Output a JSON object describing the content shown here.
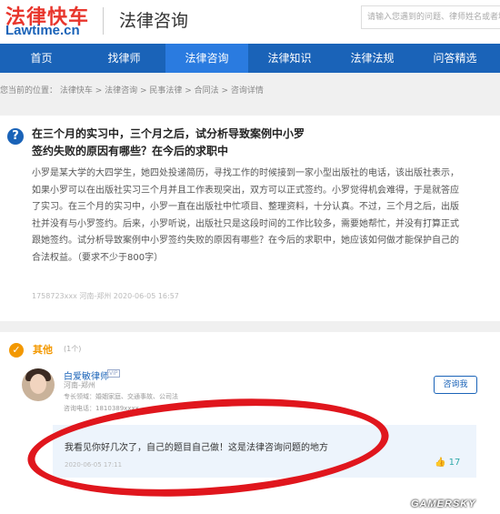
{
  "header": {
    "logo_cn": "法律快车",
    "logo_en": "Lawtime.cn",
    "site_title": "法律咨询",
    "search_placeholder": "请输入您遇到的问题、律师姓名或者地区"
  },
  "nav": [
    "首页",
    "找律师",
    "法律咨询",
    "法律知识",
    "法律法规",
    "问答精选"
  ],
  "breadcrumb": "您当前的位置：  法律快车 > 法律咨询 > 民事法律 > 合同法 > 咨询详情",
  "question": {
    "title": "在三个月的实习中，三个月之后，试分析导致案例中小罗签约失败的原因有哪些？在今后的求职中",
    "body": "小罗是某大学的大四学生，她四处投递简历，寻找工作的时候接到一家小型出版社的电话，该出版社表示，如果小罗可以在出版社实习三个月并且工作表现突出，双方可以正式签约。小罗觉得机会难得，于是就答应了实习。在三个月的实习中，小罗一直在出版社中忙项目、整理资料，十分认真。不过，三个月之后，出版社并没有与小罗签约。后来，小罗听说，出版社只是这段时间的工作比较多，需要她帮忙，并没有打算正式跟她签约。试分析导致案例中小罗签约失败的原因有哪些？在今后的求职中，她应该如何做才能保护自己的合法权益。（要求不少于800字）",
    "meta": "1758723xxx   河南-郑州      2020-06-05 16:57"
  },
  "answers": {
    "section_title": "其他",
    "count": "(1个)",
    "lawyer": {
      "name": "白爱敏律师",
      "badge": "VIP",
      "location": "河南-郑州",
      "field": "专长领域：婚姻家庭、交通事故、公司法",
      "phone": "咨询电话：1810389xxxx"
    },
    "consult_label": "咨询我",
    "text": "我看见你好几次了，自己的题目自己做！这是法律咨询问题的地方",
    "time": "2020-06-05 17:11",
    "likes": "17"
  },
  "watermark": "GAMERSKY"
}
